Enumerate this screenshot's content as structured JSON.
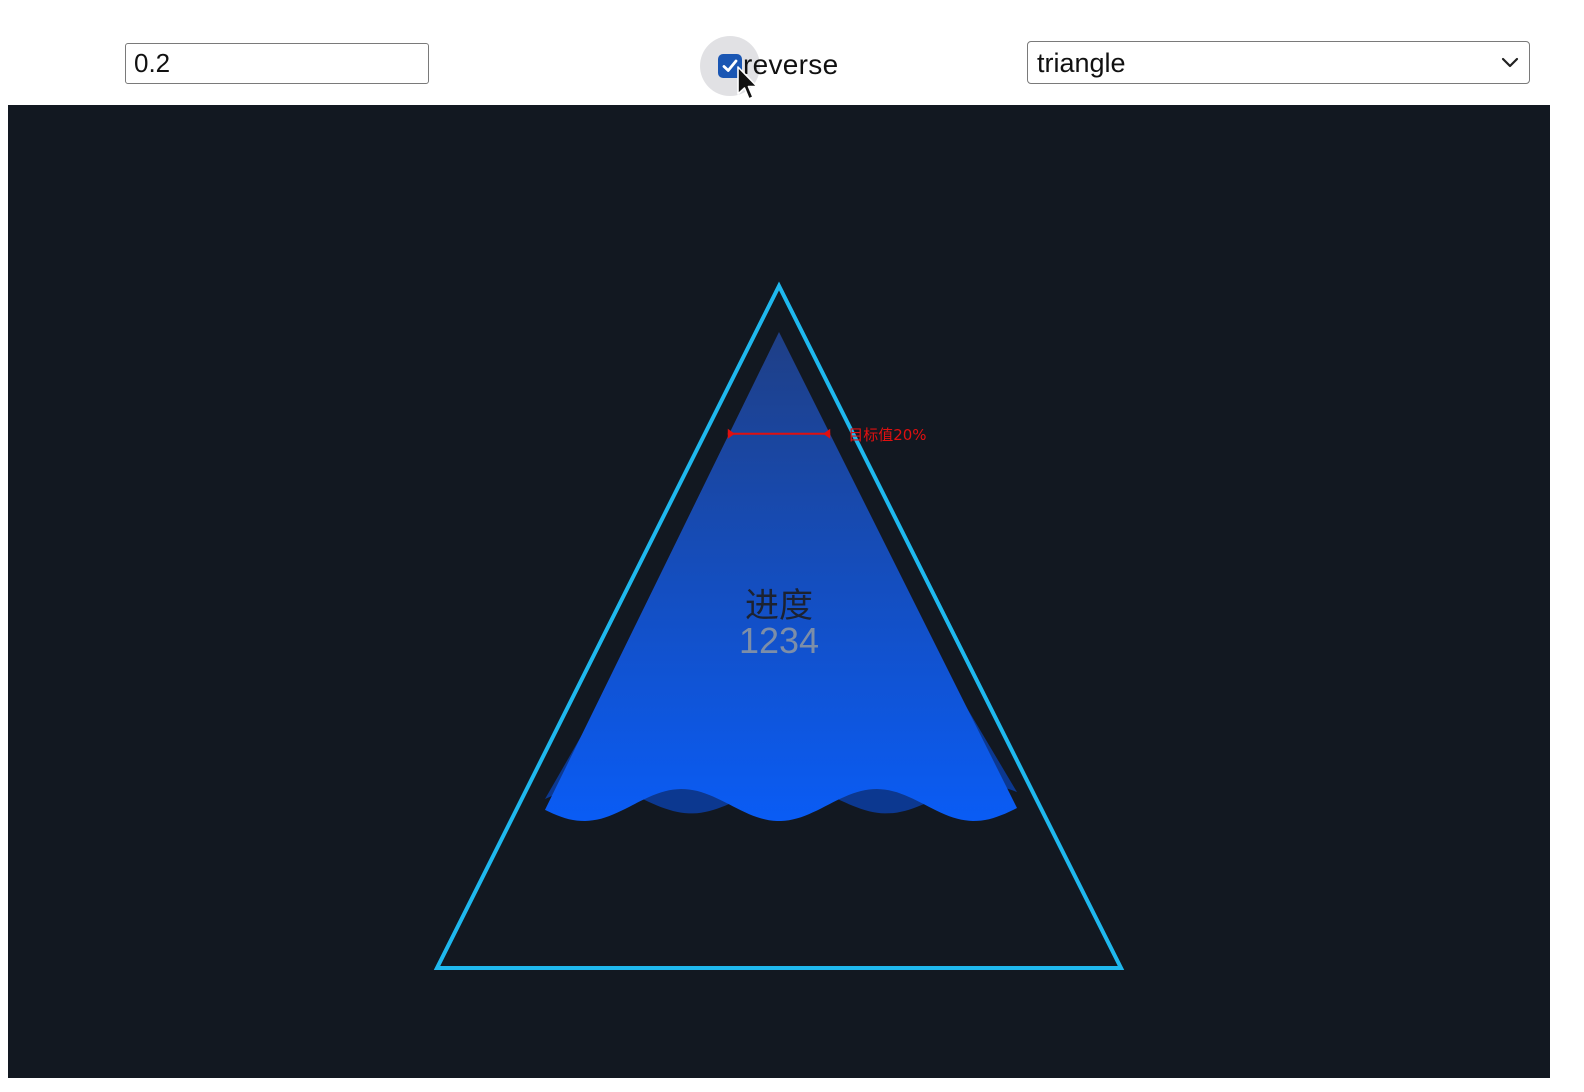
{
  "controls": {
    "value_input": "0.2",
    "reverse_checked": true,
    "reverse_label": "reverse",
    "shape_selected": "triangle"
  },
  "chart_data": {
    "type": "liquidfill",
    "shape": "triangle",
    "value": 0.2,
    "reverse": true,
    "title": "进度",
    "value_label": "1234",
    "target": {
      "value": 0.2,
      "label": "目标值20%"
    }
  },
  "colors": {
    "canvas_background": "#121821",
    "outline": "#1fb8ee",
    "liquid_top": "#1f3f86",
    "liquid_bottom": "#0a5cf5",
    "target_line": "#e01010",
    "checkbox": "#1a56b3"
  },
  "icons": {
    "checkbox": "checkmark-icon",
    "select_chevron": "chevron-down-icon",
    "cursor": "mouse-pointer-icon"
  }
}
